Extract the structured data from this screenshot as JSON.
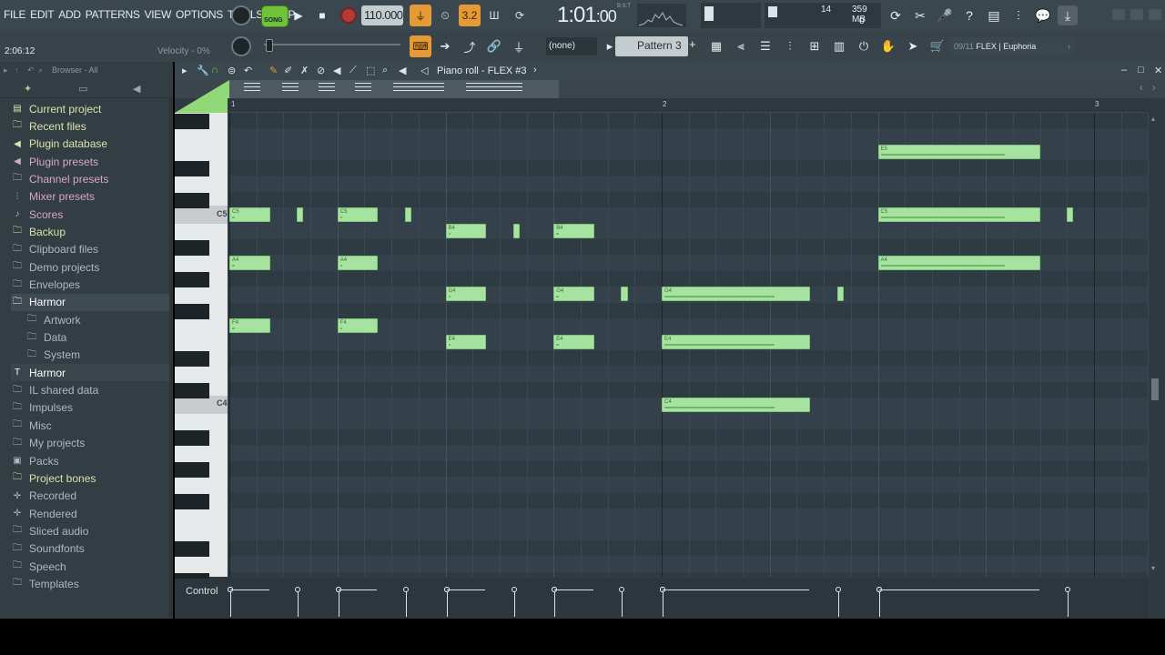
{
  "menu": [
    "FILE",
    "EDIT",
    "ADD",
    "PATTERNS",
    "VIEW",
    "OPTIONS",
    "TOOLS",
    "HELP"
  ],
  "transport": {
    "mode": "SONG",
    "tempo": "110.000",
    "time_main": "1:01",
    "time_sub": "00",
    "time_unit": "B:S:T",
    "cpu_num": "14",
    "mem": "359 MB",
    "poly": "0",
    "snap_label": "3.2"
  },
  "hint": {
    "time_pos": "2:06:12",
    "velocity": "Velocity - 0%"
  },
  "toolbar2": {
    "none_select": "(none)",
    "pattern": "Pattern 3",
    "plugin_num": "09/11",
    "plugin_name": "FLEX | Euphoria"
  },
  "browser": {
    "title": "Browser - All",
    "items": [
      {
        "label": "Current project",
        "icon": "project-icon",
        "glyph": "▤",
        "style": "yellow"
      },
      {
        "label": "Recent files",
        "icon": "folder-icon",
        "glyph": "🗀",
        "style": "yellow"
      },
      {
        "label": "Plugin database",
        "icon": "plug-icon",
        "glyph": "◀",
        "style": "yellow"
      },
      {
        "label": "Plugin presets",
        "icon": "plug-icon",
        "glyph": "◀",
        "style": "pink"
      },
      {
        "label": "Channel presets",
        "icon": "folder-icon",
        "glyph": "🗀",
        "style": "pink"
      },
      {
        "label": "Mixer presets",
        "icon": "mixer-icon",
        "glyph": "⫶",
        "style": "pink"
      },
      {
        "label": "Scores",
        "icon": "note-icon",
        "glyph": "♪",
        "style": "pink"
      },
      {
        "label": "Backup",
        "icon": "folder-icon",
        "glyph": "🗀",
        "style": "yellow"
      },
      {
        "label": "Clipboard files",
        "icon": "folder-icon",
        "glyph": "🗀",
        "style": ""
      },
      {
        "label": "Demo projects",
        "icon": "folder-icon",
        "glyph": "🗀",
        "style": ""
      },
      {
        "label": "Envelopes",
        "icon": "folder-icon",
        "glyph": "🗀",
        "style": ""
      },
      {
        "label": "Harmor",
        "icon": "folder-icon",
        "glyph": "🗀",
        "style": "sel"
      },
      {
        "label": "Artwork",
        "icon": "folder-icon",
        "glyph": "🗀",
        "style": "",
        "indent": 1
      },
      {
        "label": "Data",
        "icon": "folder-icon",
        "glyph": "🗀",
        "style": "",
        "indent": 1
      },
      {
        "label": "System",
        "icon": "folder-icon",
        "glyph": "🗀",
        "style": "",
        "indent": 1
      },
      {
        "label": "Harmor",
        "icon": "text-icon",
        "glyph": "T",
        "style": "sel2"
      },
      {
        "label": "IL shared data",
        "icon": "folder-icon",
        "glyph": "🗀",
        "style": ""
      },
      {
        "label": "Impulses",
        "icon": "folder-icon",
        "glyph": "🗀",
        "style": ""
      },
      {
        "label": "Misc",
        "icon": "folder-icon",
        "glyph": "🗀",
        "style": ""
      },
      {
        "label": "My projects",
        "icon": "folder-icon",
        "glyph": "🗀",
        "style": ""
      },
      {
        "label": "Packs",
        "icon": "pack-icon",
        "glyph": "▣",
        "style": ""
      },
      {
        "label": "Project bones",
        "icon": "folder-icon",
        "glyph": "🗀",
        "style": "yellow"
      },
      {
        "label": "Recorded",
        "icon": "record-icon",
        "glyph": "✛",
        "style": ""
      },
      {
        "label": "Rendered",
        "icon": "render-icon",
        "glyph": "✛",
        "style": ""
      },
      {
        "label": "Sliced audio",
        "icon": "folder-icon",
        "glyph": "🗀",
        "style": ""
      },
      {
        "label": "Soundfonts",
        "icon": "folder-icon",
        "glyph": "🗀",
        "style": ""
      },
      {
        "label": "Speech",
        "icon": "folder-icon",
        "glyph": "🗀",
        "style": ""
      },
      {
        "label": "Templates",
        "icon": "folder-icon",
        "glyph": "🗀",
        "style": ""
      }
    ]
  },
  "pianoroll": {
    "title": "Piano roll - FLEX #3",
    "ruler": [
      "1",
      "2",
      "3"
    ],
    "key_labels": {
      "c5": "C5",
      "c4": "C4"
    },
    "control_label": "Control",
    "notes": [
      {
        "pitch": "C5",
        "start": 0.0,
        "len": 0.375
      },
      {
        "pitch": "C5",
        "start": 1.0,
        "len": 0.375
      },
      {
        "pitch": "C5",
        "start": 0.625,
        "len": 0.06
      },
      {
        "pitch": "C5",
        "start": 1.625,
        "len": 0.06
      },
      {
        "pitch": "B4",
        "start": 2.0,
        "len": 0.375
      },
      {
        "pitch": "B4",
        "start": 3.0,
        "len": 0.375
      },
      {
        "pitch": "B4",
        "start": 2.625,
        "len": 0.06
      },
      {
        "pitch": "A4",
        "start": 0.0,
        "len": 0.375
      },
      {
        "pitch": "A4",
        "start": 1.0,
        "len": 0.375
      },
      {
        "pitch": "G4",
        "start": 2.0,
        "len": 0.375
      },
      {
        "pitch": "G4",
        "start": 3.0,
        "len": 0.375
      },
      {
        "pitch": "G4",
        "start": 3.625,
        "len": 0.06
      },
      {
        "pitch": "G4",
        "start": 4.0,
        "len": 1.375
      },
      {
        "pitch": "G4",
        "start": 5.625,
        "len": 0.06
      },
      {
        "pitch": "F4",
        "start": 0.0,
        "len": 0.375
      },
      {
        "pitch": "F4",
        "start": 1.0,
        "len": 0.375
      },
      {
        "pitch": "E4",
        "start": 2.0,
        "len": 0.375
      },
      {
        "pitch": "E4",
        "start": 3.0,
        "len": 0.375
      },
      {
        "pitch": "E4",
        "start": 4.0,
        "len": 1.375
      },
      {
        "pitch": "C4",
        "start": 4.0,
        "len": 1.375
      },
      {
        "pitch": "E5",
        "start": 6.0,
        "len": 1.5
      },
      {
        "pitch": "C5",
        "start": 6.0,
        "len": 1.5
      },
      {
        "pitch": "C5",
        "start": 7.75,
        "len": 0.06
      },
      {
        "pitch": "A4",
        "start": 6.0,
        "len": 1.5
      }
    ]
  }
}
